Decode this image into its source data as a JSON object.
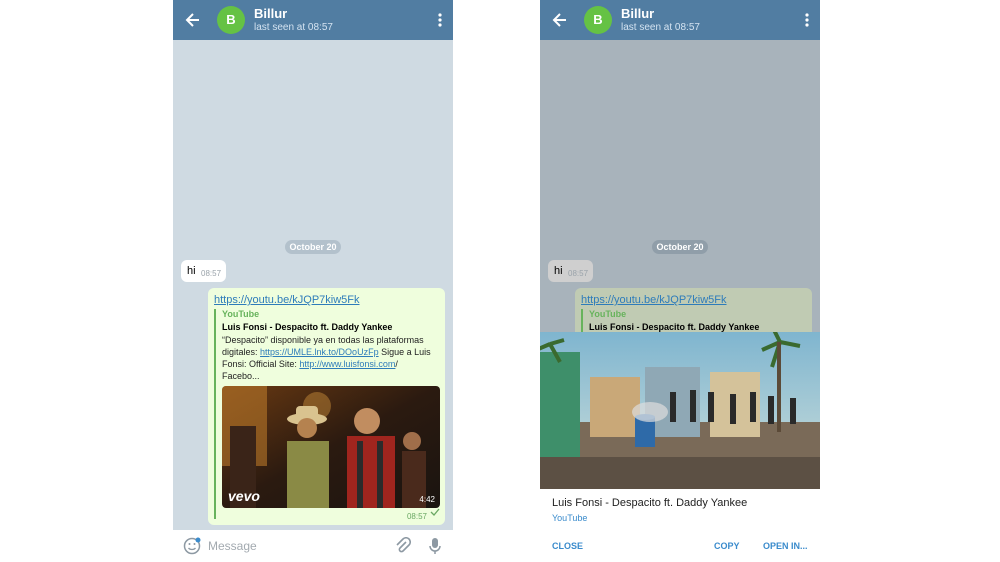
{
  "contact": {
    "initial": "B",
    "name": "Billur",
    "status": "last seen at 08:57"
  },
  "chat": {
    "date": "October 20",
    "incoming": {
      "text": "hi",
      "time": "08:57"
    },
    "outgoing": {
      "url": "https://youtu.be/kJQP7kiw5Fk",
      "site": "YouTube",
      "title": "Luis Fonsi - Despacito ft. Daddy Yankee",
      "desc_1": "“Despacito” disponible ya en todas las plataformas digitales: ",
      "desc_link_1": "https://UMLE.lnk.to/DOoUzFp",
      "desc_2": " Sigue a Luis Fonsi: Official Site: ",
      "desc_link_2": "http://www.luisfonsi.com",
      "desc_3": "/ Facebo...",
      "vevo": "vevo",
      "duration": "4:42",
      "time": "08:57"
    }
  },
  "input": {
    "placeholder": "Message"
  },
  "sheet": {
    "title": "Luis Fonsi - Despacito ft. Daddy Yankee",
    "subtitle": "YouTube",
    "close_label": "CLOSE",
    "copy_label": "COPY",
    "open_label": "OPEN IN..."
  },
  "colors": {
    "header": "#517da2",
    "link": "#2e7cba",
    "site": "#67b35c",
    "outgoing_bubble": "#effedd"
  }
}
